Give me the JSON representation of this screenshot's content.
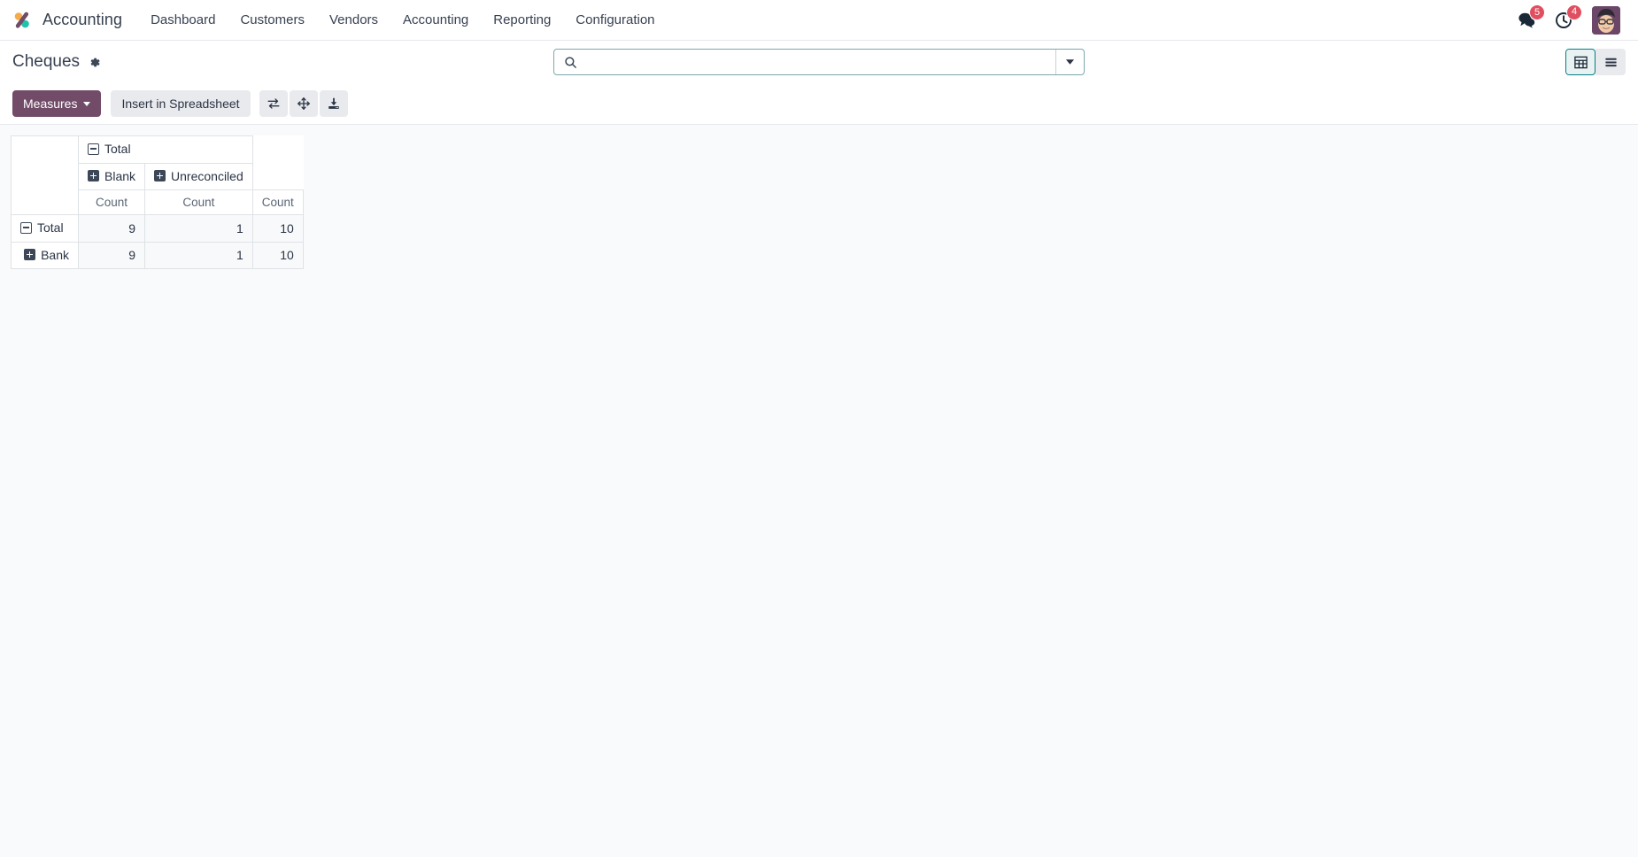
{
  "navbar": {
    "logo_icon": "odoo-logo-icon",
    "brand": "Accounting",
    "menu": [
      {
        "label": "Dashboard"
      },
      {
        "label": "Customers"
      },
      {
        "label": "Vendors"
      },
      {
        "label": "Accounting"
      },
      {
        "label": "Reporting"
      },
      {
        "label": "Configuration"
      }
    ],
    "messages": {
      "icon": "messages-icon",
      "count": "5"
    },
    "activities": {
      "icon": "clock-icon",
      "count": "4"
    },
    "avatar": {
      "icon": "user-avatar"
    }
  },
  "control_panel": {
    "breadcrumb": "Cheques",
    "gear_icon": "gear-icon",
    "search": {
      "icon": "search-icon",
      "value": "",
      "placeholder": "",
      "toggle_icon": "chevron-down-icon"
    },
    "view_switcher": [
      {
        "name": "pivot",
        "icon": "pivot-view-icon",
        "active": true
      },
      {
        "name": "list",
        "icon": "list-view-icon",
        "active": false
      }
    ],
    "buttons": {
      "measures": "Measures",
      "insert_spreadsheet": "Insert in Spreadsheet",
      "flip_axis_icon": "flip-axis-icon",
      "expand_all_icon": "expand-all-icon",
      "download_icon": "download-xlsx-icon"
    }
  },
  "pivot": {
    "col_group_header": "Total",
    "col_headers": [
      "Blank",
      "Unreconciled"
    ],
    "measure_label": "Count",
    "measure_headers": [
      "Count",
      "Count",
      "Count"
    ],
    "rows": [
      {
        "label": "Total",
        "state": "expanded",
        "values": [
          "9",
          "1",
          "10"
        ]
      },
      {
        "label": "Bank",
        "state": "collapsed",
        "values": [
          "9",
          "1",
          "10"
        ]
      }
    ]
  },
  "colors": {
    "brand_purple": "#714b67",
    "accent_teal": "#017e84",
    "badge_red": "#e04f5f",
    "page_bg": "#f9fafb"
  }
}
